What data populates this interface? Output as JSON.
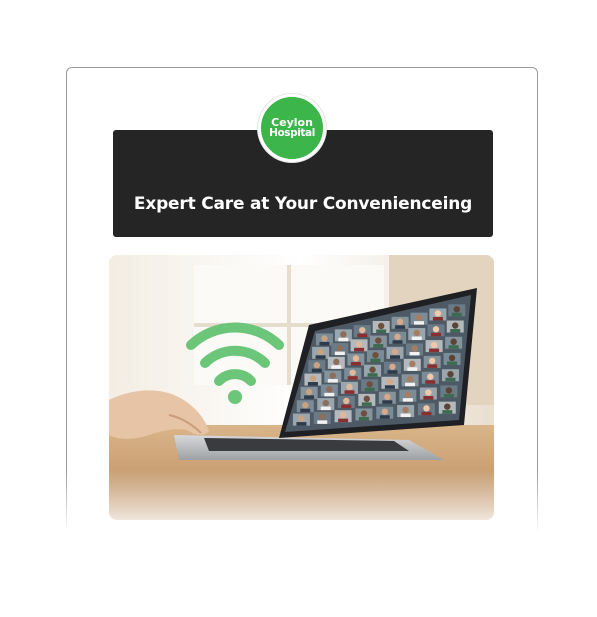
{
  "logo": {
    "line1": "Ceylon",
    "line2": "Hospital"
  },
  "banner": {
    "title": "Expert Care at Your Convenienceing"
  },
  "colors": {
    "brand_green": "#3cb54a",
    "banner_bg": "#252525",
    "wifi_green": "#6cc67a"
  },
  "photo": {
    "icon": "wifi-icon"
  }
}
